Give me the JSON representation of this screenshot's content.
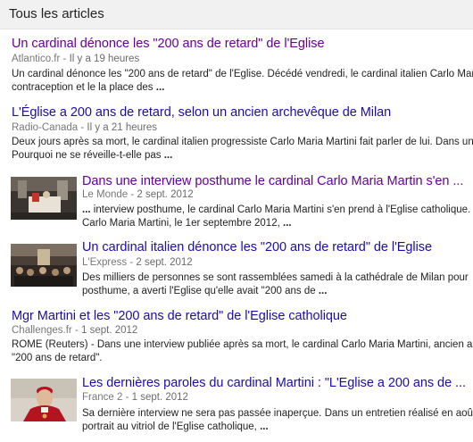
{
  "header": {
    "title": "Tous les articles"
  },
  "articles": [
    {
      "title": "Un cardinal dénonce les \"200 ans de retard\" de l'Eglise",
      "source": "Atlantico.fr",
      "date": "Il y a 19 heures",
      "snippet_line1": "Un cardinal dénonce les \"200 ans de retard\" de l'Eglise. Décédé vendredi, le cardinal italien Carlo Marti",
      "snippet_line2": "contraception et le la place des",
      "more": "...",
      "visited": true
    },
    {
      "title": "L'Église a 200 ans de retard, selon un ancien archevêque de Milan",
      "source": "Radio-Canada",
      "date": "Il y a 21 heures",
      "snippet_line1": "Deux jours après sa mort, le cardinal italien progressiste Carlo Maria Martini fait parler de lui. Dans un",
      "snippet_line2": "Pourquoi ne se réveille-t-elle pas",
      "more": "...",
      "visited": false
    },
    {
      "title": "Dans une interview posthume le cardinal Carlo Maria Martin s'en ...",
      "source": "Le Monde",
      "date": "2 sept. 2012",
      "snippet_line1": "interview posthume, le cardinal Carlo Maria Martini s'en prend à l'Eglise catholique. L",
      "snippet_lead": "...",
      "snippet_line2": "Carlo Maria Martini, le 1er septembre 2012,",
      "more": "...",
      "visited": true,
      "thumb_icon": "church-interior-photo"
    },
    {
      "title": "Un cardinal italien dénonce les \"200 ans de retard\" de l'Eglise",
      "source": "L'Express",
      "date": "2 sept. 2012",
      "snippet_line1": "Des milliers de personnes se sont rassemblées samedi à la cathédrale de Milan pour",
      "snippet_line2": "posthume, a averti l'Eglise qu'elle avait \"200 ans de",
      "more": "...",
      "visited": false,
      "thumb_icon": "cathedral-crowd-photo"
    },
    {
      "title": "Mgr Martini et les \"200 ans de retard\" de l'Eglise catholique",
      "source": "Challenges.fr",
      "date": "1 sept. 2012",
      "snippet_line1": "ROME (Reuters) - Dans une interview publiée après sa mort, le cardinal Carlo Maria Martini, ancien ar",
      "snippet_line2": "\"200 ans de retard\".",
      "more": "",
      "visited": false
    },
    {
      "title": "Les dernières paroles du cardinal Martini : \"L'Eglise a 200 ans de ...",
      "source": "France 2",
      "date": "1 sept. 2012",
      "snippet_line1": "Sa dernière interview ne sera pas passée inaperçue. Dans un entretien réalisé en août",
      "snippet_line2": "portrait au vitriol de l'Eglise catholique,",
      "more": "...",
      "visited": false,
      "thumb_icon": "cardinal-portrait-photo"
    }
  ],
  "separator": " - ",
  "colors": {
    "visited_link": "#660099",
    "link": "#1a0dab",
    "source_text": "#777777",
    "header_bg": "#f1f1f1"
  }
}
